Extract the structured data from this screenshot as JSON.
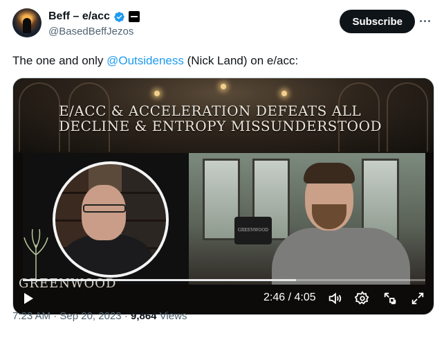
{
  "author": {
    "display_name": "Beff – e/acc",
    "handle": "@BasedBeffJezos",
    "verified": true,
    "avatar": "avatar-image"
  },
  "actions": {
    "subscribe_label": "Subscribe",
    "more_icon": "more-horizontal-icon"
  },
  "tweet": {
    "text_before": "The one and only ",
    "mention": "@Outsideness",
    "text_after": " (Nick Land) on e/acc:"
  },
  "video": {
    "headline_line1": "E/ACC & ACCELERATION DEFEATS ALL",
    "headline_line2": "DECLINE & ENTROPY MISSUNDERSTOOD",
    "brand": "GREENWOOD",
    "desk_logo": "GREENWOOD",
    "current_time": "2:46",
    "duration": "4:05",
    "progress_fraction": 0.678,
    "icons": [
      "play-icon",
      "volume-icon",
      "settings-gear-icon",
      "picture-in-picture-icon",
      "fullscreen-icon"
    ]
  },
  "meta": {
    "time": "7:23 AM",
    "date": "Sep 20, 2023",
    "views_count": "9,864",
    "views_label": "Views",
    "separator": "·"
  },
  "colors": {
    "text": "#0f1419",
    "secondary": "#536471",
    "link": "#1d9bf0",
    "button_bg": "#0f1419"
  }
}
